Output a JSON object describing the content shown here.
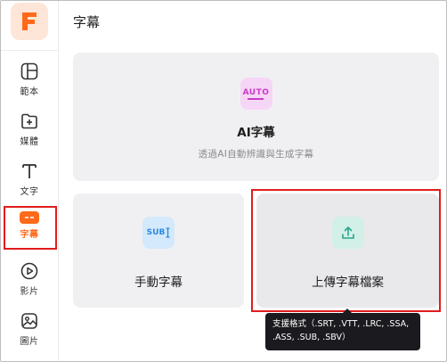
{
  "app": {
    "logo_letter": "F",
    "brand_color": "#ff6a1a"
  },
  "page": {
    "title": "字幕"
  },
  "sidebar": {
    "items": [
      {
        "label": "範本",
        "icon": "template-icon"
      },
      {
        "label": "媒體",
        "icon": "add-media-icon"
      },
      {
        "label": "文字",
        "icon": "text-icon"
      },
      {
        "label": "字幕",
        "icon": "subtitle-icon",
        "active": true
      },
      {
        "label": "影片",
        "icon": "play-icon"
      },
      {
        "label": "圖片",
        "icon": "image-icon"
      }
    ]
  },
  "cards": {
    "auto": {
      "icon_text": "AUTO",
      "title": "AI字幕",
      "subtitle": "透過AI自動辨識與生成字幕"
    },
    "manual": {
      "icon_text": "SUB",
      "title": "手動字幕"
    },
    "upload": {
      "title": "上傳字幕檔案"
    }
  },
  "tooltip": {
    "text": "支援格式（.SRT, .VTT, .LRC, .SSA, .ASS, .SUB, .SBV）"
  }
}
